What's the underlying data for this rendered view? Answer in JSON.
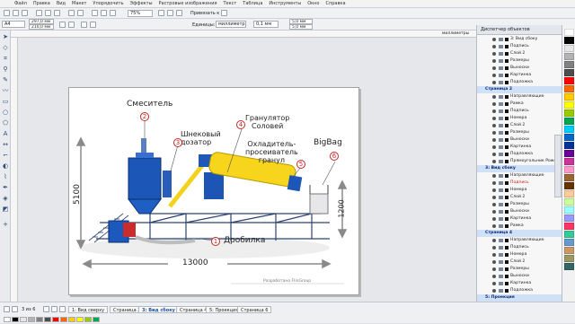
{
  "menu": [
    "Файл",
    "Правка",
    "Вид",
    "Макет",
    "Упорядочить",
    "Эффекты",
    "Растровые изображения",
    "Текст",
    "Таблица",
    "Инструменты",
    "Окно",
    "Справка"
  ],
  "toolbar": {
    "page_size": "A4",
    "width": "297,0 мм",
    "height": "210,0 мм",
    "zoom": "75%",
    "snap": "Привязать к",
    "units_label": "Единицы:",
    "units_value": "миллиметры",
    "nudge": "0,1 мм",
    "dup_x": "5,0 мм",
    "dup_y": "5,0 мм"
  },
  "ruler_label": "миллиметры",
  "illustration": {
    "mixer": "Смеситель",
    "screw": "Шнековый\nдозатор",
    "granulator": "Гранулятор\nСоловей",
    "cooler": "Охладитель-\nпросеиватель\nгранул",
    "bigbag": "BigBag",
    "crusher": "Дробилка",
    "num_1": "1",
    "num_2": "2",
    "num_3": "3",
    "num_4": "4",
    "num_5": "5",
    "num_6": "6",
    "dim_height": "5100",
    "dim_length": "13000",
    "dim_small_h": "1200",
    "footer": "Разработано FlinGroup"
  },
  "docker": {
    "title": "Диспетчер объектов",
    "rows": [
      {
        "type": "sub",
        "text": "3: Вид сбоку"
      },
      {
        "type": "sub",
        "text": "Подпись"
      },
      {
        "type": "layer",
        "text": "Слой 2"
      },
      {
        "type": "layer",
        "text": "Размеры"
      },
      {
        "type": "layer",
        "text": "Выноски"
      },
      {
        "type": "layer",
        "text": "Картинка"
      },
      {
        "type": "layer",
        "text": "Подложка"
      },
      {
        "type": "page",
        "text": "Страница 2"
      },
      {
        "type": "layer",
        "text": "Направляющие"
      },
      {
        "type": "layer",
        "text": "Рамка"
      },
      {
        "type": "layer",
        "text": "Подпись"
      },
      {
        "type": "layer",
        "text": "Номера"
      },
      {
        "type": "layer",
        "text": "Слой 2"
      },
      {
        "type": "layer",
        "text": "Размеры"
      },
      {
        "type": "layer",
        "text": "Выноски"
      },
      {
        "type": "layer",
        "text": "Картинка"
      },
      {
        "type": "layer",
        "text": "Подложка"
      },
      {
        "type": "layer",
        "text": "Прямоугольник PowerC"
      },
      {
        "type": "page",
        "text": "3: Вид сбоку"
      },
      {
        "type": "layer",
        "text": "Направляющие"
      },
      {
        "type": "red",
        "text": "Подпись"
      },
      {
        "type": "layer",
        "text": "Номера"
      },
      {
        "type": "layer",
        "text": "Слой 2"
      },
      {
        "type": "layer",
        "text": "Размеры"
      },
      {
        "type": "layer",
        "text": "Выноски"
      },
      {
        "type": "layer",
        "text": "Картинка"
      },
      {
        "type": "layer",
        "text": "Рамка"
      },
      {
        "type": "page",
        "text": "Страница 4"
      },
      {
        "type": "layer",
        "text": "Направляющие"
      },
      {
        "type": "layer",
        "text": "Подпись"
      },
      {
        "type": "layer",
        "text": "Номера"
      },
      {
        "type": "layer",
        "text": "Слой 2"
      },
      {
        "type": "layer",
        "text": "Размеры"
      },
      {
        "type": "layer",
        "text": "Выноски"
      },
      {
        "type": "layer",
        "text": "Картинка"
      },
      {
        "type": "layer",
        "text": "Подложка"
      },
      {
        "type": "page",
        "text": "5: Проекция"
      },
      {
        "type": "page",
        "text": "Страница 6"
      },
      {
        "type": "layer",
        "text": "Направляющие"
      },
      {
        "type": "layer",
        "text": "Подпись"
      },
      {
        "type": "layer",
        "text": "Номера"
      },
      {
        "type": "layer",
        "text": "Слой 2"
      }
    ]
  },
  "page_counter": "3 из 6",
  "page_tabs": [
    "1: Вид сверху",
    "Страница 2",
    "3: Вид сбоку",
    "Страница 4",
    "5: Проекция",
    "Страница 6"
  ],
  "active_tab": 2,
  "palette": [
    "#ffffff",
    "#000000",
    "#e6e6e6",
    "#b3b3b3",
    "#808080",
    "#4d4d4d",
    "#ff0000",
    "#ff6600",
    "#ffcc00",
    "#ffff00",
    "#99cc00",
    "#00a651",
    "#00ccff",
    "#0066cc",
    "#003399",
    "#660099",
    "#cc3399",
    "#ff99cc",
    "#996633",
    "#663300",
    "#ffcc99",
    "#ccff99",
    "#99ffff",
    "#9999ff",
    "#ff3366",
    "#33cc99",
    "#6699cc",
    "#cc9966",
    "#999966",
    "#336666"
  ]
}
